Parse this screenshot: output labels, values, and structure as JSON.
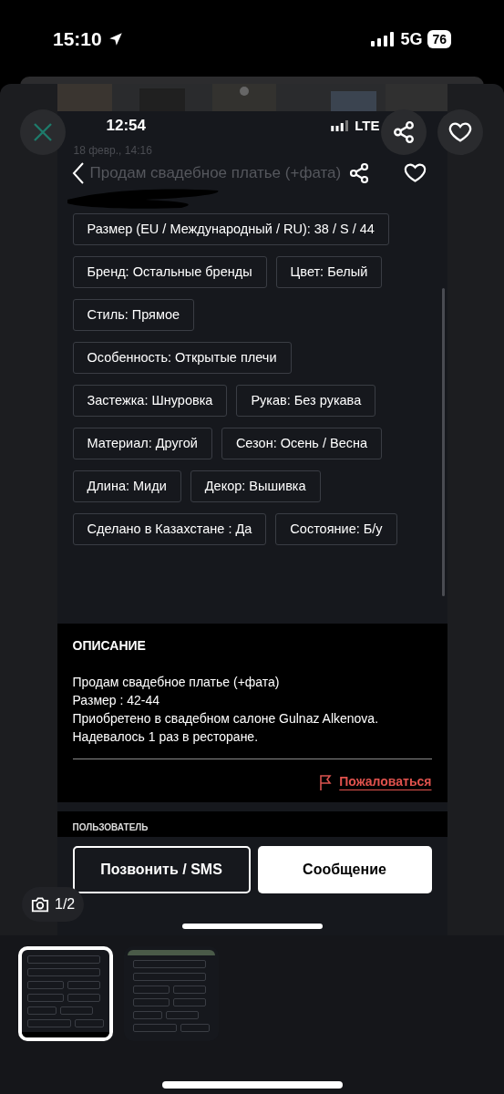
{
  "status_bar": {
    "time": "15:10",
    "network": "5G",
    "battery": "76"
  },
  "viewer": {
    "counter": "1/2"
  },
  "screenshot": {
    "status_bar": {
      "time": "12:54",
      "network": "LTE"
    },
    "listing": {
      "date": "18 февр., 14:16",
      "title": "Продам свадебное платье (+фата)"
    },
    "attribute_rows": [
      [
        "Размер (EU / Международный / RU): 38 / S / 44"
      ],
      [
        "Бренд: Остальные бренды",
        "Цвет: Белый"
      ],
      [
        "Стиль: Прямое"
      ],
      [
        "Особенность: Открытые плечи"
      ],
      [
        "Застежка: Шнуровка",
        "Рукав: Без рукава"
      ],
      [
        "Материал: Другой",
        "Сезон: Осень / Весна"
      ],
      [
        "Длина: Миди",
        "Декор: Вышивка"
      ],
      [
        "Сделано в Казахстане : Да",
        "Состояние: Б/у"
      ]
    ],
    "description": {
      "heading": "ОПИСАНИЕ",
      "lines": [
        "Продам свадебное платье (+фата)",
        "Размер : 42-44",
        "Приобретено в свадебном салоне Gulnaz Alkenova.",
        "Надевалось 1 раз в ресторане."
      ],
      "report": "Пожаловаться"
    },
    "user_section": {
      "heading": "ПОЛЬЗОВАТЕЛЬ"
    },
    "buttons": [
      {
        "kind": "outline",
        "label": "Позвонить / SMS"
      },
      {
        "kind": "filled",
        "label": "Сообщение"
      }
    ]
  },
  "thumbnails": [
    {
      "selected": true
    },
    {
      "selected": false
    }
  ]
}
